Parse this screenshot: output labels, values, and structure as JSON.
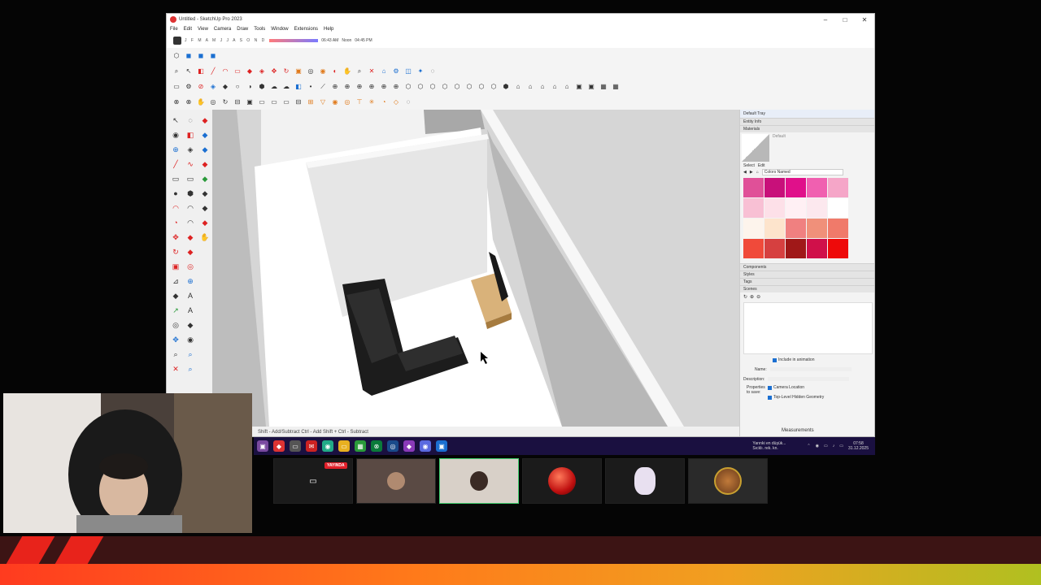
{
  "window": {
    "title": "Untitled - SketchUp Pro 2023",
    "controls": [
      "–",
      "□",
      "✕"
    ]
  },
  "menu": [
    "File",
    "Edit",
    "View",
    "Camera",
    "Draw",
    "Tools",
    "Window",
    "Extensions",
    "Help"
  ],
  "shadows": {
    "months": "J F M A M J J A S O N D",
    "time_start": "06:43 AM",
    "time_mid": "Noon",
    "time_end": "04:45 PM"
  },
  "tray": {
    "title": "Default Tray",
    "entity_info": "Entity Info",
    "materials": "Materials",
    "default_material": "Default",
    "tab_select": "Select",
    "tab_edit": "Edit",
    "palette_dropdown": "Colors Named",
    "swatch_colors": [
      "#e05098",
      "#c8107a",
      "#e0108a",
      "#f060b0",
      "#f5a6c8",
      "#f8c0d4",
      "#fde0e8",
      "#fff0f4",
      "#fce8ee",
      "#ffffff",
      "#fdf4ec",
      "#fde4cc",
      "#f08080",
      "#f0907a",
      "#f07a6a",
      "#f04a3a",
      "#d64040",
      "#a01818",
      "#d0104a",
      "#ee0a0a"
    ],
    "components": "Components",
    "styles": "Styles",
    "tags": "Tags",
    "scenes": "Scenes",
    "include_animation": "Include in animation",
    "name_label": "Name:",
    "description_label": "Description:",
    "properties_label": "Properties to save:",
    "camera_location": "Camera Location",
    "hidden_geometry": "Top-Level Hidden Geometry"
  },
  "statusbar": {
    "hint": "Shift - Add/Subtract  Ctrl - Add  Shift + Ctrl - Subtract",
    "measurements": "Measurements"
  },
  "taskbar": {
    "weather_line1": "Yarınki en düşük...",
    "weather_line2": "Sıcklı. rek. kn.",
    "time": "07:58",
    "date": "31.12.2025"
  },
  "stream": {
    "live_badge": "YAYINDA"
  }
}
